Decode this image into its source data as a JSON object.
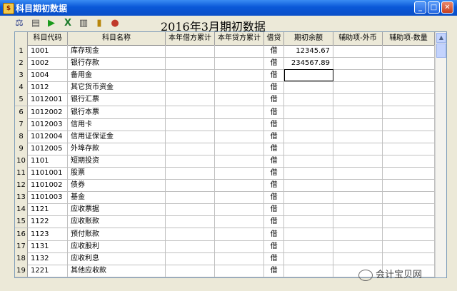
{
  "window": {
    "title": "科目期初数据"
  },
  "page_title": "2016年3月期初数据",
  "columns": [
    "科目代码",
    "科目名称",
    "本年借方累计",
    "本年贷方累计",
    "借贷",
    "期初余额",
    "辅助项-外币",
    "辅助项-数量"
  ],
  "rows": [
    {
      "n": "1",
      "code": "1001",
      "name": "库存现金",
      "dir": "借",
      "bal": "12345.67"
    },
    {
      "n": "2",
      "code": "1002",
      "name": "银行存款",
      "dir": "借",
      "bal": "234567.89"
    },
    {
      "n": "3",
      "code": "1004",
      "name": "备用金",
      "dir": "借",
      "bal": ""
    },
    {
      "n": "4",
      "code": "1012",
      "name": "其它货币资金",
      "dir": "借",
      "bal": ""
    },
    {
      "n": "5",
      "code": "1012001",
      "name": "银行汇票",
      "dir": "借",
      "bal": ""
    },
    {
      "n": "6",
      "code": "1012002",
      "name": "银行本票",
      "dir": "借",
      "bal": ""
    },
    {
      "n": "7",
      "code": "1012003",
      "name": "信用卡",
      "dir": "借",
      "bal": ""
    },
    {
      "n": "8",
      "code": "1012004",
      "name": "信用证保证金",
      "dir": "借",
      "bal": ""
    },
    {
      "n": "9",
      "code": "1012005",
      "name": "外埠存款",
      "dir": "借",
      "bal": ""
    },
    {
      "n": "10",
      "code": "1101",
      "name": "短期投资",
      "dir": "借",
      "bal": ""
    },
    {
      "n": "11",
      "code": "1101001",
      "name": "股票",
      "dir": "借",
      "bal": ""
    },
    {
      "n": "12",
      "code": "1101002",
      "name": "债券",
      "dir": "借",
      "bal": ""
    },
    {
      "n": "13",
      "code": "1101003",
      "name": "基金",
      "dir": "借",
      "bal": ""
    },
    {
      "n": "14",
      "code": "1121",
      "name": "应收票据",
      "dir": "借",
      "bal": ""
    },
    {
      "n": "15",
      "code": "1122",
      "name": "应收账款",
      "dir": "借",
      "bal": ""
    },
    {
      "n": "16",
      "code": "1123",
      "name": "预付账款",
      "dir": "借",
      "bal": ""
    },
    {
      "n": "17",
      "code": "1131",
      "name": "应收股利",
      "dir": "借",
      "bal": ""
    },
    {
      "n": "18",
      "code": "1132",
      "name": "应收利息",
      "dir": "借",
      "bal": ""
    },
    {
      "n": "19",
      "code": "1221",
      "name": "其他应收款",
      "dir": "借",
      "bal": ""
    }
  ],
  "watermark": "会计宝贝网",
  "toolbar_icons": [
    "balance-icon",
    "print-preview-icon",
    "run-icon",
    "excel-icon",
    "printer-icon",
    "exit-door-icon",
    "stop-icon"
  ]
}
